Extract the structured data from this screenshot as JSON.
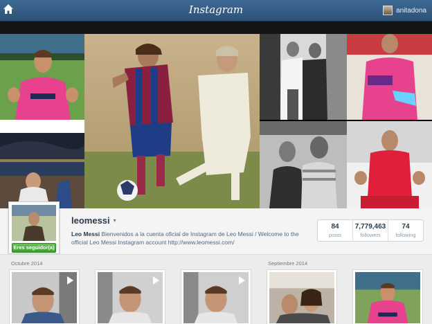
{
  "header": {
    "brand": "Instagram",
    "username": "anitadona",
    "home_icon": "home-icon"
  },
  "profile": {
    "username": "leomessi",
    "follow_label": "Eres seguidor(a)",
    "bio_name": "Leo Messi",
    "bio_text": " Bienvenidos a la cuenta oficial de Instagram de Leo Messi / Welcome to the official Leo Messi Instagram account http://www.leomessi.com/",
    "stats": [
      {
        "value": "84",
        "label": "posts"
      },
      {
        "value": "7,779,463",
        "label": "followers"
      },
      {
        "value": "74",
        "label": "following"
      }
    ]
  },
  "feed": {
    "months": [
      "Octubre 2014",
      "Septiembre 2014"
    ]
  },
  "colors": {
    "topbar": "#2c5177",
    "follow_green": "#3f9a34",
    "barca_pink": "#e6428e"
  }
}
